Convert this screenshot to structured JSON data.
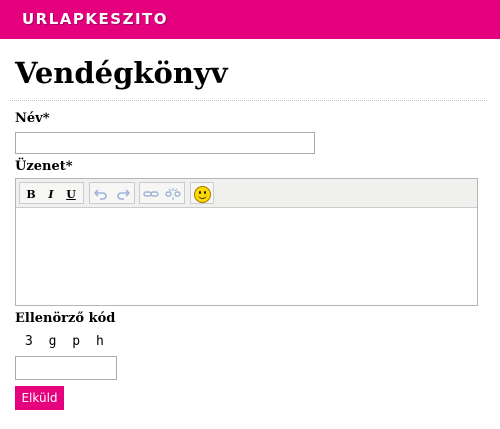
{
  "header": {
    "brand": "URLAPKESZITO",
    "accent": "#e5007e"
  },
  "form": {
    "title": "Vendégkönyv",
    "name_label": "Név*",
    "name_value": "",
    "message_label": "Üzenet*",
    "message_value": "",
    "captcha_label": "Ellenörző kód",
    "captcha_code": "3 g p h",
    "captcha_value": "",
    "submit_label": "Elküld"
  },
  "editor_toolbar": {
    "bold": "B",
    "italic": "I",
    "underline": "U",
    "icons": [
      "bold-icon",
      "italic-icon",
      "underline-icon",
      "undo-icon",
      "redo-icon",
      "link-icon",
      "unlink-icon",
      "smiley-icon"
    ]
  }
}
